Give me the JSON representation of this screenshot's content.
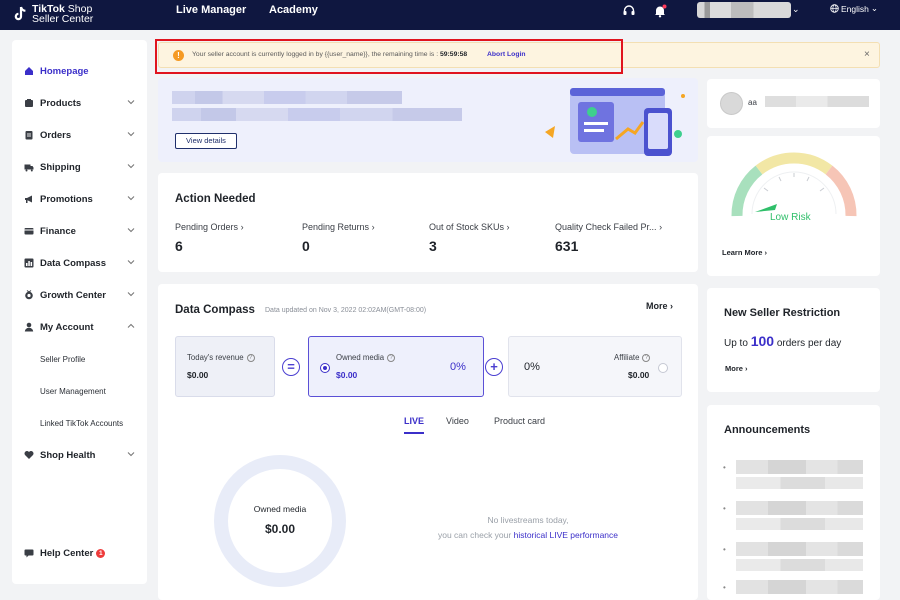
{
  "topbar": {
    "logo_line1_bold": "TikTok",
    "logo_line1_rest": " Shop",
    "logo_line2": "Seller Center",
    "nav": [
      "Live Manager",
      "Academy"
    ],
    "language": "English"
  },
  "sidebar": {
    "items": [
      {
        "label": "Homepage",
        "icon": "home-icon"
      },
      {
        "label": "Products",
        "icon": "products-icon"
      },
      {
        "label": "Orders",
        "icon": "orders-icon"
      },
      {
        "label": "Shipping",
        "icon": "shipping-icon"
      },
      {
        "label": "Promotions",
        "icon": "promotions-icon"
      },
      {
        "label": "Finance",
        "icon": "finance-icon"
      },
      {
        "label": "Data Compass",
        "icon": "data-compass-icon"
      },
      {
        "label": "Growth Center",
        "icon": "growth-icon"
      },
      {
        "label": "My Account",
        "icon": "account-icon"
      }
    ],
    "sub_items": [
      "Seller Profile",
      "User Management",
      "Linked TikTok Accounts"
    ],
    "shop_health": "Shop Health",
    "help_center": "Help Center",
    "help_badge": "1"
  },
  "alert": {
    "text_prefix": "Your seller account is currently logged in by {{user_name}}, the remaining time is : ",
    "time": "59:59:58",
    "link": "Abort Login",
    "close": "×"
  },
  "hero": {
    "button": "View details"
  },
  "action_needed": {
    "title": "Action Needed",
    "metrics": [
      {
        "label": "Pending Orders",
        "value": "6"
      },
      {
        "label": "Pending Returns",
        "value": "0"
      },
      {
        "label": "Out of Stock SKUs",
        "value": "3"
      },
      {
        "label": "Quality Check Failed Pr...",
        "value": "631"
      }
    ]
  },
  "data_compass": {
    "title": "Data Compass",
    "updated": "Data updated on Nov 3, 2022 02:02AM(GMT-08:00)",
    "more": "More",
    "revenue_label": "Today's revenue",
    "revenue_value": "$0.00",
    "equals": "=",
    "owned_label": "Owned media",
    "owned_value": "$0.00",
    "owned_pct": "0%",
    "plus": "+",
    "aff_pct": "0%",
    "aff_label": "Affiliate",
    "aff_value": "$0.00",
    "tabs": [
      "LIVE",
      "Video",
      "Product card"
    ],
    "donut_label": "Owned media",
    "donut_value": "$0.00",
    "empty_line1": "No livestreams today,",
    "empty_line2": "you can check your ",
    "empty_link": "historical LIVE performance"
  },
  "profile": {
    "name_prefix": "aa"
  },
  "risk": {
    "label": "Low Risk",
    "learn_more": "Learn More",
    "level": "low",
    "colors": {
      "low": "#2fbf6a",
      "mid": "#e9d86a",
      "high": "#f0a08a"
    }
  },
  "restriction": {
    "title": "New Seller Restriction",
    "prefix": "Up to ",
    "amount": "100",
    "suffix": " orders per day",
    "more": "More"
  },
  "announcements": {
    "title": "Announcements"
  },
  "colors": {
    "accent": "#3b2fc9",
    "nav_bg": "#0f1740",
    "alert_border": "#e0141e"
  }
}
